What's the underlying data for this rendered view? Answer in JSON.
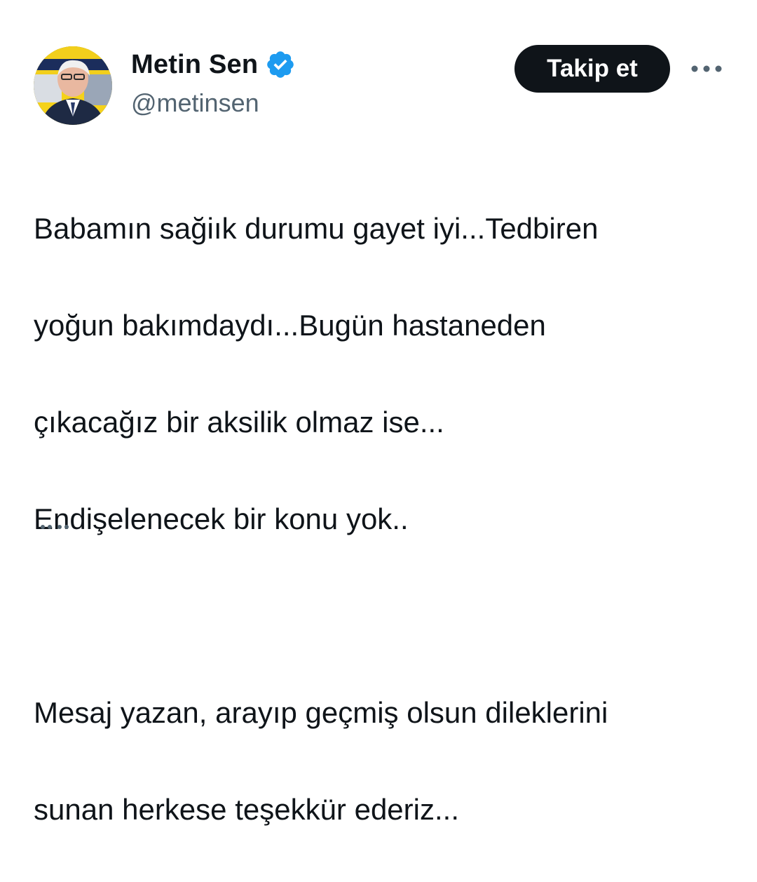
{
  "author": {
    "display_name": "Metin Sen",
    "handle": "@metinsen",
    "verified_icon": "verified-badge-icon",
    "avatar": "profile-photo"
  },
  "actions": {
    "follow_label": "Takip et",
    "more_icon": "more-horizontal-icon"
  },
  "tweet": {
    "paragraph1": [
      "Babamın sağiık durumu gayet iyi...Tedbiren",
      "yoğun bakımdaydı...Bugün hastaneden",
      "çıkacağız bir aksilik olmaz ise...",
      "Endişelenecek bir konu yok.."
    ],
    "paragraph2": [
      "Mesaj yazan, arayıp geçmiş olsun dileklerini",
      "sunan herkese teşekkür ederiz..."
    ]
  },
  "colors": {
    "text": "#0f1419",
    "secondary": "#536471",
    "verified": "#1d9bf0",
    "follow_button_bg": "#0f1419",
    "follow_button_text": "#ffffff"
  }
}
